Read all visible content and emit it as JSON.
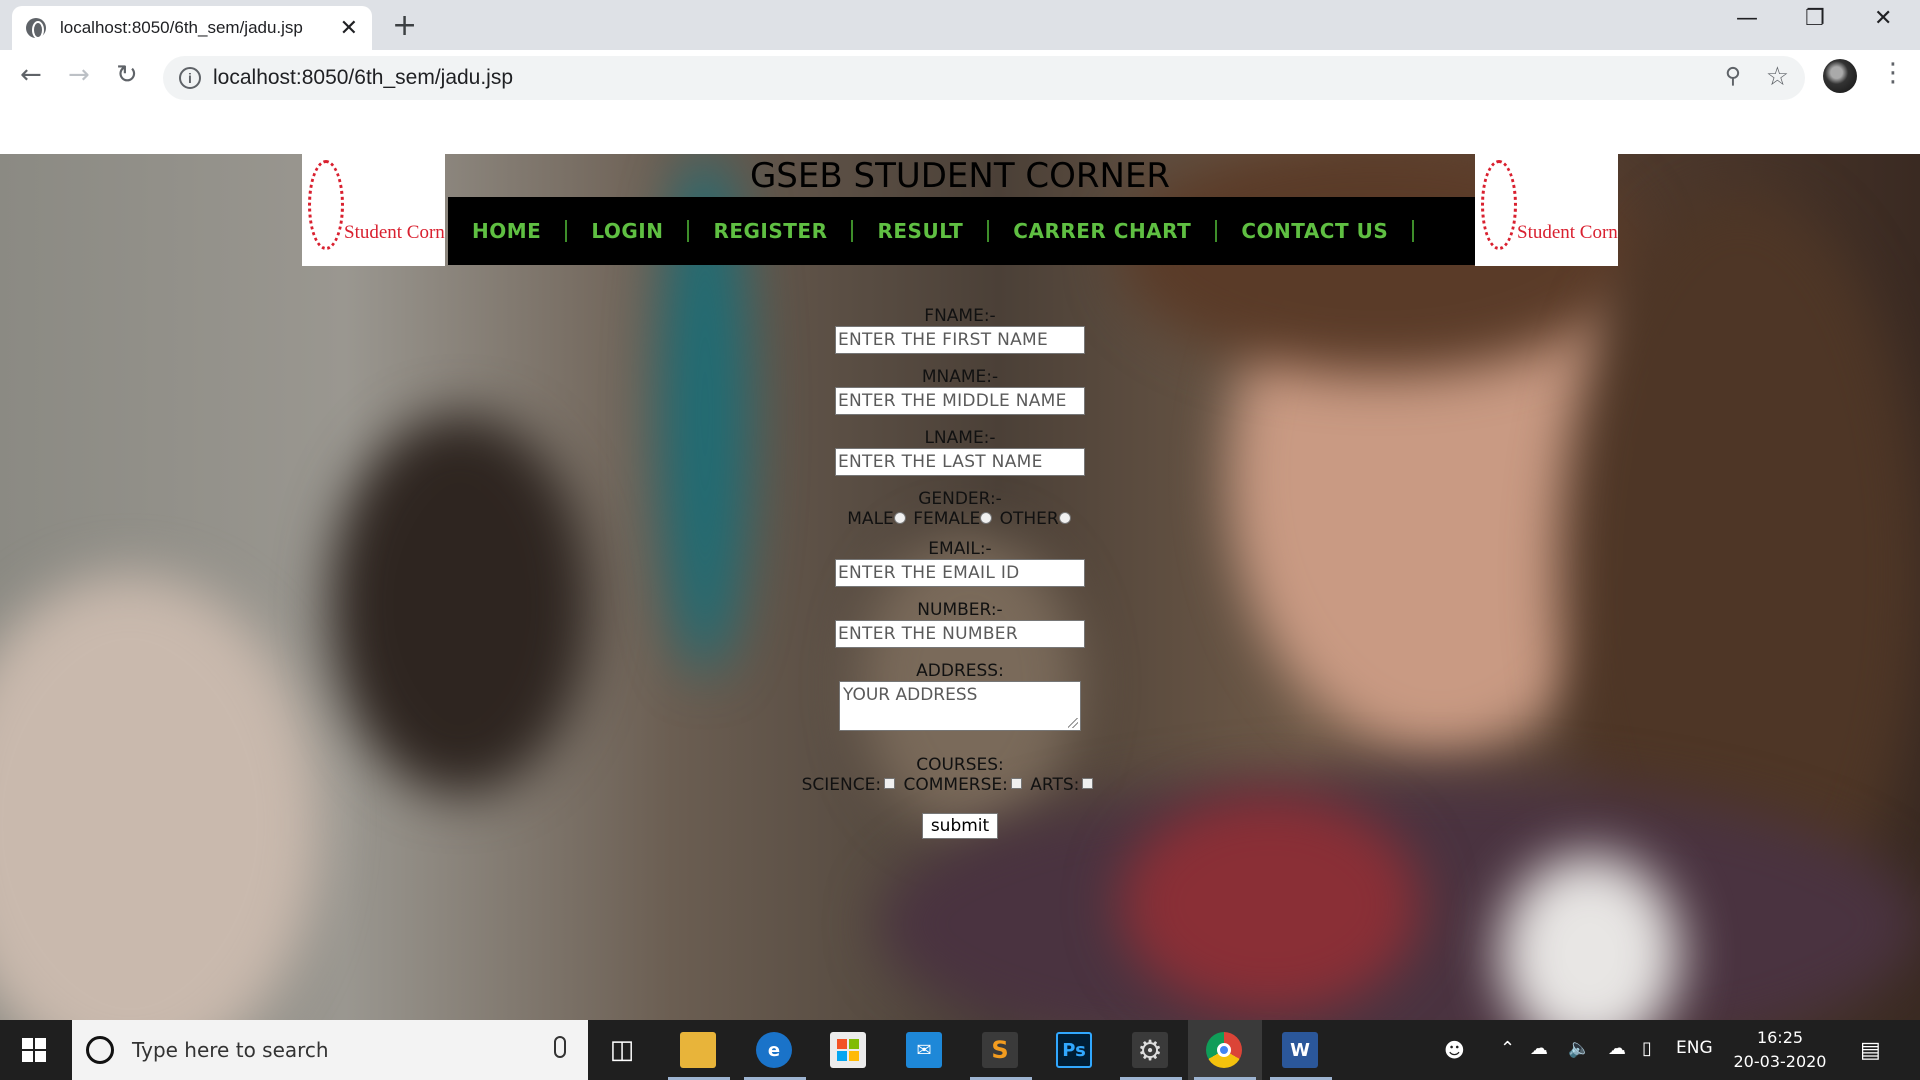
{
  "browser": {
    "tab_title": "localhost:8050/6th_sem/jadu.jsp",
    "tab_close": "✕",
    "new_tab": "+",
    "url": "localhost:8050/6th_sem/jadu.jsp",
    "window_controls": {
      "minimize": "—",
      "restore": "❐",
      "close": "✕"
    },
    "nav": {
      "back": "←",
      "forward": "→",
      "reload": "↻"
    },
    "icons": [
      "globe-icon",
      "info-icon",
      "zoom-icon",
      "star-icon",
      "profile-avatar",
      "menu-icon"
    ]
  },
  "page": {
    "title": "GSEB STUDENT CORNER",
    "logo_text": "Student Corner",
    "nav_color": "#5fbf42",
    "nav_items": [
      "HOME",
      "LOGIN",
      "REGISTER",
      "RESULT",
      "CARRER CHART",
      "CONTACT US"
    ]
  },
  "form": {
    "fname_label": "FNAME:-",
    "fname_placeholder": "ENTER THE FIRST NAME",
    "mname_label": "MNAME:-",
    "mname_placeholder": "ENTER THE MIDDLE NAME",
    "lname_label": "LNAME:-",
    "lname_placeholder": "ENTER THE LAST NAME",
    "gender_label": "GENDER:-",
    "gender_options": [
      "MALE",
      "FEMALE",
      "OTHER"
    ],
    "email_label": "EMAIL:-",
    "email_placeholder": "ENTER THE EMAIL ID",
    "number_label": "NUMBER:-",
    "number_placeholder": "ENTER THE NUMBER",
    "address_label": "ADDRESS:",
    "address_placeholder": "YOUR ADDRESS",
    "courses_label": "COURSES:",
    "course_options": [
      "SCIENCE:",
      "COMMERSE:",
      "ARTS:"
    ],
    "submit_label": "submit"
  },
  "taskbar": {
    "search_placeholder": "Type here to search",
    "apps": [
      "task-view",
      "file-explorer",
      "edge",
      "store",
      "mail",
      "sublime-text",
      "photoshop",
      "settings",
      "chrome",
      "word"
    ],
    "tray": {
      "language": "ENG"
    },
    "time": "16:25",
    "date": "20-03-2020"
  }
}
